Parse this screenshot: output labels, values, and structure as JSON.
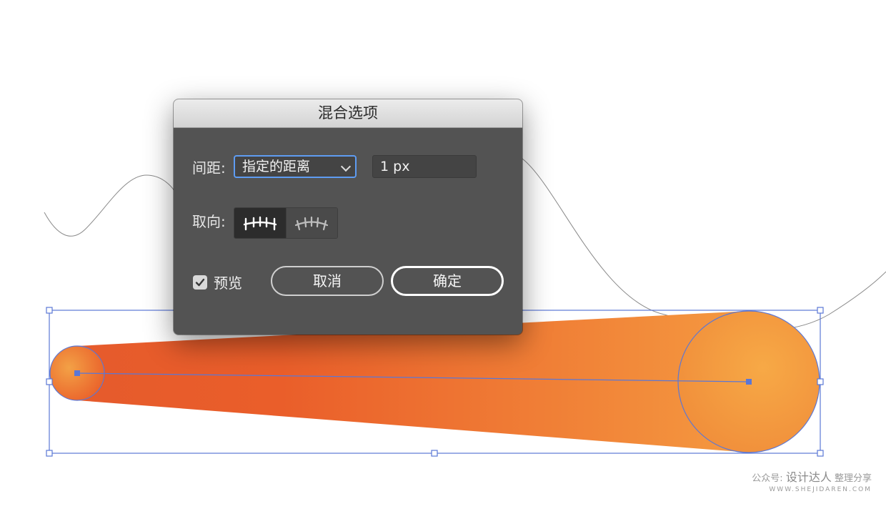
{
  "dialog": {
    "title": "混合选项",
    "spacing_label": "间距:",
    "spacing_mode": "指定的距离",
    "distance_value": "1 px",
    "orientation_label": "取向:",
    "orientation_selected": "align-to-page",
    "preview_label": "预览",
    "preview_checked": true,
    "cancel_label": "取消",
    "ok_label": "确定"
  },
  "artwork": {
    "gradient_start_color": "#ea5326",
    "gradient_end_color": "#f6a344",
    "selection_color": "#5b77d6",
    "path_color": "#8a8a8a"
  },
  "watermark": {
    "prefix": "公众号:",
    "brand": "设计达人",
    "suffix": "整理分享",
    "url": "WWW.SHEJIDAREN.COM"
  }
}
